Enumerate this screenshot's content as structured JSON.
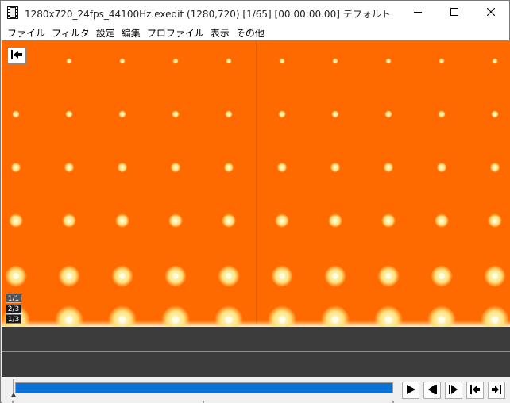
{
  "window": {
    "title": "1280x720_24fps_44100Hz.exedit (1280,720)  [1/65] [00:00:00.00]  デフォルト",
    "icon": "film-strip-icon",
    "controls": [
      "minimize-icon",
      "maximize-icon",
      "close-icon"
    ]
  },
  "menu": {
    "items": [
      {
        "label": "ファイル"
      },
      {
        "label": "フィルタ"
      },
      {
        "label": "設定"
      },
      {
        "label": "編集"
      },
      {
        "label": "プロファイル"
      },
      {
        "label": "表示"
      },
      {
        "label": "その他"
      }
    ]
  },
  "preview": {
    "background_color": "#ff6a00",
    "sparkle_color": "#ffe27a",
    "back_button_icon": "jump-to-start-icon",
    "layer_badges": [
      "1/1",
      "2/3",
      "1/3"
    ]
  },
  "timeline": {
    "background_color": "#3c3c3c",
    "marker_line_color": "#33cc33"
  },
  "playback": {
    "seek_fill_color": "#0a72d4",
    "buttons": [
      {
        "icon": "play-icon"
      },
      {
        "icon": "step-back-icon"
      },
      {
        "icon": "step-forward-icon"
      },
      {
        "icon": "go-to-start-icon"
      },
      {
        "icon": "go-to-end-icon"
      }
    ]
  }
}
